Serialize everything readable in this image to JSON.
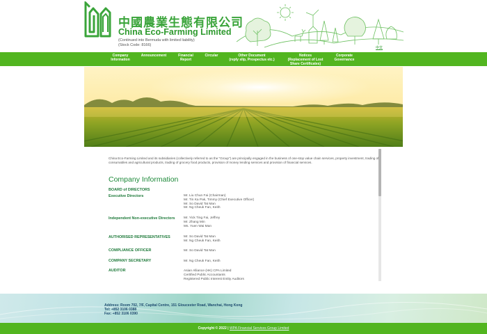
{
  "header": {
    "company_cn": "中國農業生態有限公司",
    "company_en": "China Eco-Farming Limited",
    "sub_line1": "(Continued into Bermuda with limited liability)",
    "sub_line2": "(Stock Code: 8166)",
    "lang_link": "中文",
    "brand_color": "#3aa43a"
  },
  "nav": {
    "items": [
      {
        "line1": "Company",
        "line2": "Information"
      },
      {
        "line1": "Announcement",
        "line2": ""
      },
      {
        "line1": "Financial",
        "line2": "Report"
      },
      {
        "line1": "Circular",
        "line2": ""
      },
      {
        "line1": "Other Document",
        "line2": "(reply slip, Prospectus etc.)"
      },
      {
        "line1": "Notices",
        "line2": "(Replacement of Lost",
        "line3": "Share Certificates)"
      },
      {
        "line1": "Corporate",
        "line2": "Governance"
      }
    ],
    "bar_color": "#52b520"
  },
  "main": {
    "intro": "China Eco-Farming Limited and its subsidiaries (collectively referred to as the \"Group\") are principally engaged in the business of one-stop value chain services, property investment, trading of consumables and agricultural products, trading of grocery food products, provision of money lending services and provision of financial services.",
    "title": "Company Information",
    "board_heading": "BOARD of DIRECTORS",
    "exec_label": "Executive Directors",
    "exec_directors": [
      "Mr. Liu Chun Fai (Chairman)",
      "Mr. Tin Ka Pak, Timmy (Chief Executive Officer)",
      "Mr. So David Tat Man",
      "Mr. Ng Cheuk Fan, Keith"
    ],
    "ined_label": "Independent Non-executive Directors",
    "ined_directors": [
      "Mr. Yick Ting Fai, Jeffrey",
      "Mr. Zhang Min",
      "Ms. Yuen Wai Man"
    ],
    "auth_label": "AUTHORISED REPRESENTATIVES",
    "auth_values": [
      "Mr. So David Tat Man",
      "Mr. Ng Cheuk Fan, Keith"
    ],
    "compliance_label": "COMPLIANCE OFFICER",
    "compliance_values": [
      "Mr. So David Tat Man"
    ],
    "secretary_label": "COMPANY SECRETARY",
    "secretary_values": [
      "Mr. Ng Cheuk Fan, Keith"
    ],
    "auditor_label": "AUDITOR",
    "auditor_values": [
      "Asian Alliance (HK) CPA Limited",
      "Certified Public Accountants",
      "Registered Public Interest Entity Auditors"
    ]
  },
  "footer": {
    "address": "Address: Room 702, 7/F, Capital Centre, 151 Gloucester Road, Wanchai, Hong Kong",
    "tel": "Tel:  +852 3106 0388",
    "fax": "Fax: +852 3106 0390",
    "copyright_prefix": "Copyright © 2022  |",
    "copyright_link": "WPA Financial Services Group Limited"
  }
}
